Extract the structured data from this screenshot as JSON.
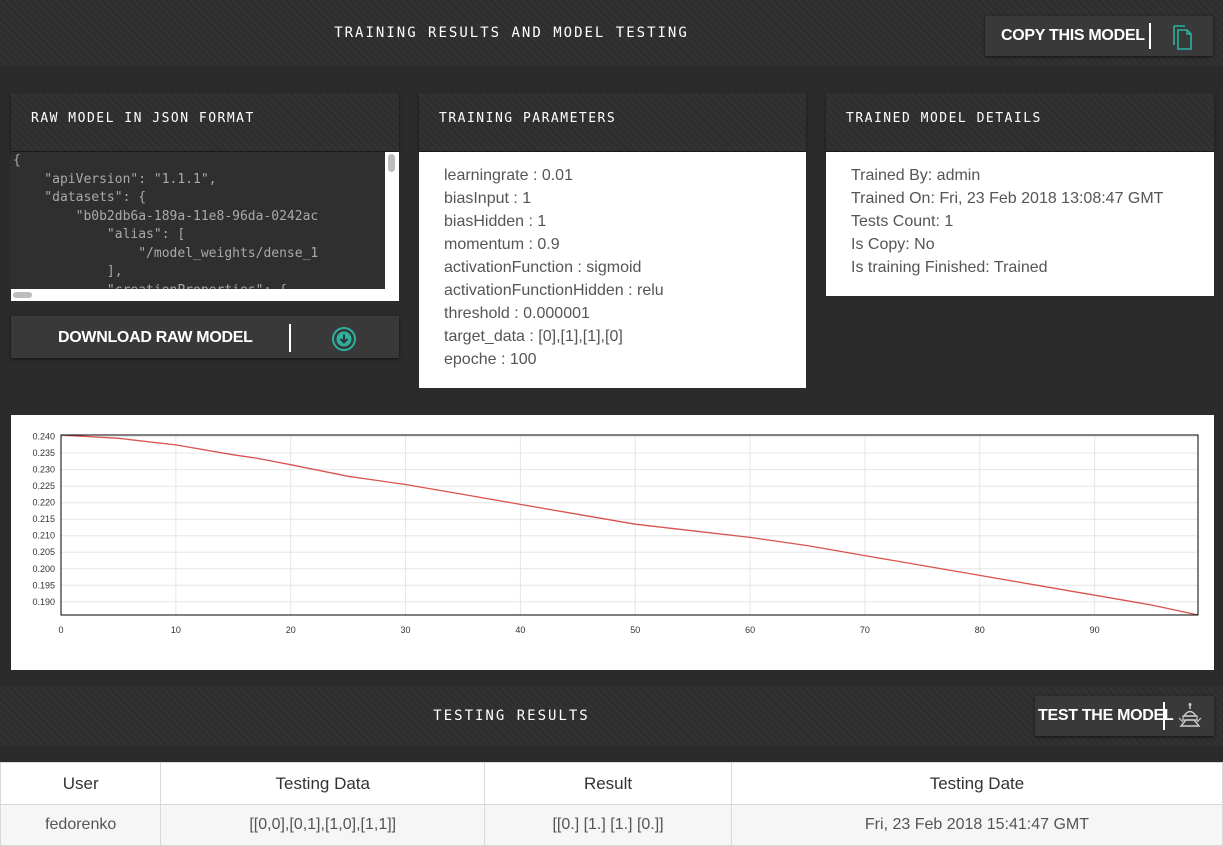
{
  "header": {
    "title": "TRAINING RESULTS AND MODEL TESTING",
    "copy_button": "COPY THIS MODEL"
  },
  "raw_model": {
    "title": "RAW MODEL IN JSON FORMAT",
    "json_lines": [
      "{",
      "    \"apiVersion\": \"1.1.1\",",
      "    \"datasets\": {",
      "        \"b0b2db6a-189a-11e8-96da-0242ac",
      "            \"alias\": [",
      "                \"/model_weights/dense_1",
      "            ],",
      "            \"creationProperties\": {"
    ],
    "download_button": "DOWNLOAD RAW MODEL"
  },
  "training_parameters": {
    "title": "TRAINING PARAMETERS",
    "items": [
      "learningrate : 0.01",
      "biasInput : 1",
      "biasHidden : 1",
      "momentum : 0.9",
      "activationFunction : sigmoid",
      "activationFunctionHidden : relu",
      "threshold : 0.000001",
      "target_data : [0],[1],[1],[0]",
      "epoche : 100"
    ]
  },
  "model_details": {
    "title": "TRAINED MODEL DETAILS",
    "items": [
      "Trained By: admin",
      "Trained On: Fri, 23 Feb 2018 13:08:47 GMT",
      "Tests Count: 1",
      "Is Copy: No",
      "Is training Finished: Trained"
    ]
  },
  "chart_data": {
    "type": "line",
    "title": "",
    "xlabel": "",
    "ylabel": "",
    "xlim": [
      0,
      99
    ],
    "ylim": [
      0.186,
      0.2405
    ],
    "x_ticks": [
      0,
      10,
      20,
      30,
      40,
      50,
      60,
      70,
      80,
      90
    ],
    "y_ticks": [
      0.19,
      0.195,
      0.2,
      0.205,
      0.21,
      0.215,
      0.22,
      0.225,
      0.23,
      0.235,
      0.24
    ],
    "grid": true,
    "series": [
      {
        "color": "#d9534f",
        "points": [
          [
            0,
            0.2405
          ],
          [
            5,
            0.2395
          ],
          [
            10,
            0.2375
          ],
          [
            15,
            0.2345
          ],
          [
            17,
            0.2335
          ],
          [
            20,
            0.2315
          ],
          [
            25,
            0.228
          ],
          [
            30,
            0.2255
          ],
          [
            35,
            0.2225
          ],
          [
            40,
            0.2195
          ],
          [
            45,
            0.2165
          ],
          [
            50,
            0.2135
          ],
          [
            55,
            0.2115
          ],
          [
            60,
            0.2095
          ],
          [
            65,
            0.207
          ],
          [
            70,
            0.204
          ],
          [
            75,
            0.201
          ],
          [
            80,
            0.198
          ],
          [
            85,
            0.195
          ],
          [
            90,
            0.192
          ],
          [
            95,
            0.189
          ],
          [
            99,
            0.186
          ]
        ]
      }
    ]
  },
  "testing": {
    "title": "TESTING RESULTS",
    "test_button": "TEST THE MODEL",
    "columns": [
      "User",
      "Testing Data",
      "Result",
      "Testing Date"
    ],
    "rows": [
      [
        "fedorenko",
        "[[0,0],[0,1],[1,0],[1,1]]",
        "[[0.] [1.] [1.] [0.]]",
        "Fri, 23 Feb 2018 15:41:47 GMT"
      ]
    ]
  },
  "icons": {
    "copy": "copy-icon",
    "download": "download-circle-icon",
    "test": "robot-icon"
  },
  "colors": {
    "accent": "#2bb3a0",
    "line": "#d9534f"
  }
}
